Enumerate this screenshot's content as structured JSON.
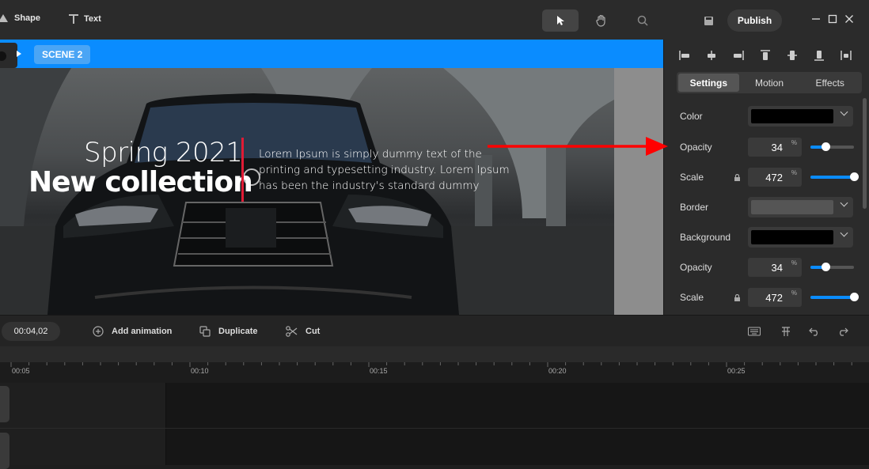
{
  "toolbar": {
    "shape_label": "Shape",
    "text_label": "Text",
    "publish_label": "Publish"
  },
  "scene": {
    "label": "SCENE 2"
  },
  "canvas": {
    "title_line1": "Spring 2021",
    "title_line2": "New collection",
    "body": "Lorem Ipsum is simply dummy text of the printing and typesetting industry. Lorem Ipsum has been the industry's standard dummy"
  },
  "panel": {
    "tabs": [
      "Settings",
      "Motion",
      "Effects"
    ],
    "active_tab": "Settings",
    "color_label": "Color",
    "color_value": "#000000",
    "opacity_label": "Opacity",
    "opacity_value": "34",
    "opacity_unit": "%",
    "opacity_level": 0.34,
    "scale_label": "Scale",
    "scale_value": "472",
    "scale_unit": "%",
    "scale_level": 1.0,
    "border_label": "Border",
    "background_label": "Background",
    "background_value": "#000000",
    "opacity2_label": "Opacity",
    "opacity2_value": "34",
    "opacity2_unit": "%",
    "opacity2_level": 0.34,
    "scale2_label": "Scale",
    "scale2_value": "472",
    "scale2_unit": "%",
    "scale2_level": 1.0
  },
  "actions": {
    "time": "00:04,02",
    "add_animation": "Add animation",
    "duplicate": "Duplicate",
    "cut": "Cut"
  },
  "timeline": {
    "ticks": [
      "00:05",
      "00:10",
      "00:15",
      "00:20",
      "00:25"
    ]
  },
  "colors": {
    "accent": "#0a8cff",
    "title_bar": "#e01b35",
    "annotation_arrow": "#ff0000"
  }
}
